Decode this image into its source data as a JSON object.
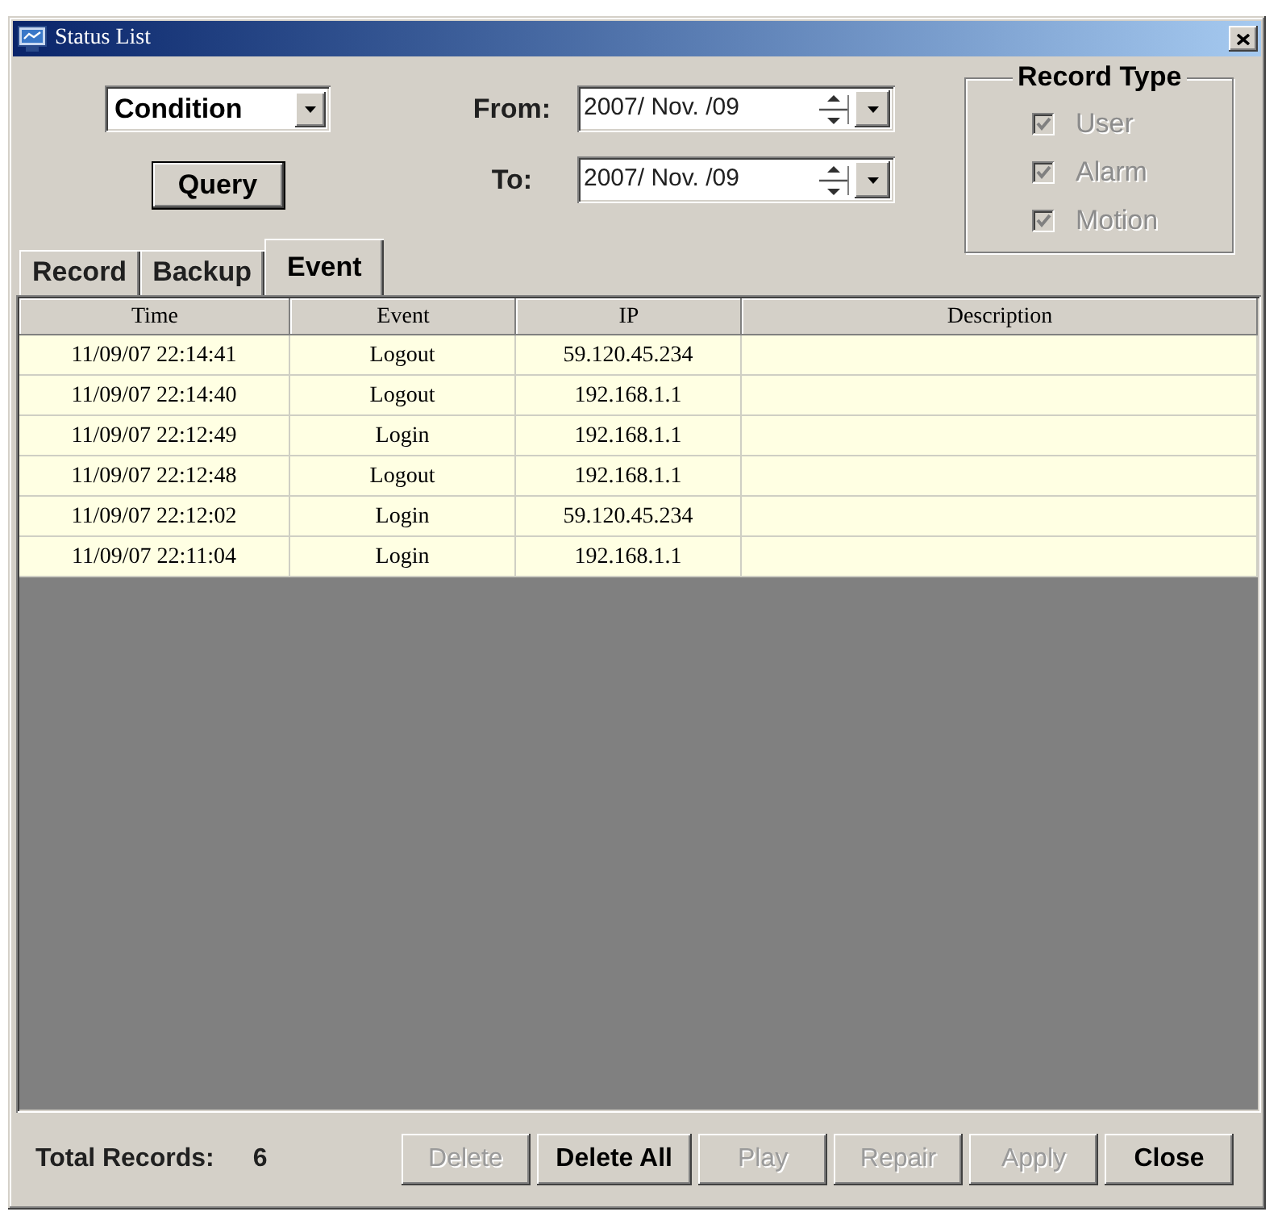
{
  "window": {
    "title": "Status List"
  },
  "query": {
    "condition": {
      "value": "Condition"
    },
    "button": {
      "label": "Query"
    },
    "dates": [
      {
        "label": "From:",
        "value": "2007/ Nov. /09"
      },
      {
        "label": "To:",
        "value": "2007/ Nov. /09"
      }
    ]
  },
  "record_type": {
    "title": "Record Type",
    "options": [
      {
        "label": "User",
        "checked": true,
        "disabled": true
      },
      {
        "label": "Alarm",
        "checked": true,
        "disabled": true
      },
      {
        "label": "Motion",
        "checked": true,
        "disabled": true
      }
    ]
  },
  "tabs": [
    {
      "label": "Record",
      "selected": false
    },
    {
      "label": "Backup",
      "selected": false
    },
    {
      "label": "Event",
      "selected": true
    }
  ],
  "table": {
    "columns": [
      "Time",
      "Event",
      "IP",
      "Description"
    ],
    "rows": [
      [
        "11/09/07 22:14:41",
        "Logout",
        "59.120.45.234"
      ],
      [
        "11/09/07 22:14:40",
        "Logout",
        "192.168.1.1"
      ],
      [
        "11/09/07 22:12:49",
        "Login",
        "192.168.1.1"
      ],
      [
        "11/09/07 22:12:48",
        "Logout",
        "192.168.1.1"
      ],
      [
        "11/09/07 22:12:02",
        "Login",
        "59.120.45.234"
      ],
      [
        "11/09/07 22:11:04",
        "Login",
        "192.168.1.1"
      ]
    ]
  },
  "footer": {
    "total_label": "Total Records:",
    "total_value": "6",
    "buttons": [
      {
        "label": "Delete",
        "disabled": true
      },
      {
        "label": "Delete All",
        "disabled": false
      },
      {
        "label": "Play",
        "disabled": true
      },
      {
        "label": "Repair",
        "disabled": true
      },
      {
        "label": "Apply",
        "disabled": true
      },
      {
        "label": "Close",
        "disabled": false
      }
    ]
  }
}
